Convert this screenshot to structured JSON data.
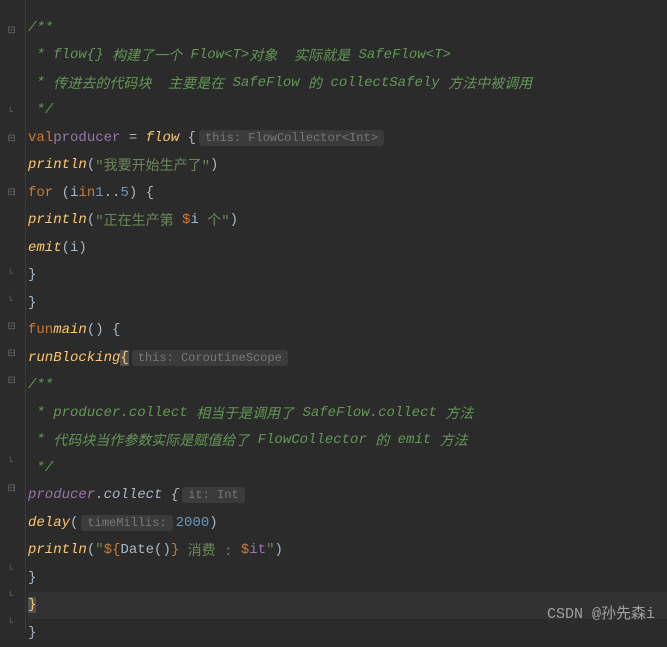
{
  "doc": {
    "l1": "/**",
    "l2a": " * flow{}",
    "l2b": " 构建了一个 ",
    "l2c": "Flow<T>",
    "l2d": "对象  实际就是 ",
    "l2e": "SafeFlow<T>",
    "l3a": " * ",
    "l3b": "传进去的代码块  主要是在 ",
    "l3c": "SafeFlow",
    "l3d": " 的 ",
    "l3e": "collectSafely",
    "l3f": " 方法中被调用",
    "l4": " */"
  },
  "kw": {
    "val": "val",
    "for": "for",
    "in": "in",
    "fun": "fun"
  },
  "code": {
    "producer": "producer",
    "eq": " = ",
    "flow": "flow",
    "openB": " {",
    "println": "println",
    "p1str": "\"我要开始生产了\"",
    "closeP": ")",
    "forOpen": " (",
    "i": "i",
    "range1": "1",
    "dotdot": "..",
    "range2": "5",
    "forClose": ") {",
    "p2str1": "\"正在生产第 ",
    "p2str2": " 个\"",
    "emit": "emit",
    "emitArg": "(i)",
    "closeB": "}",
    "main": "main",
    "mainParens": "() {",
    "runBlocking": "runBlocking",
    "doc2_1": "/**",
    "doc2_2a": " * producer.collect",
    "doc2_2b": " 相当于是调用了 ",
    "doc2_2c": "SafeFlow.collect",
    "doc2_2d": " 方法",
    "doc2_3a": " * ",
    "doc2_3b": "代码块当作参数实际是赋值给了 ",
    "doc2_3c": "FlowCollector",
    "doc2_3d": " 的 ",
    "doc2_3e": "emit",
    "doc2_3f": " 方法",
    "doc2_4": " */",
    "collect": ".collect {",
    "delay": "delay",
    "delayOpen": "(",
    "delayNum": "2000",
    "delayClose": ")",
    "p3open": "(",
    "p3q1": "\"",
    "date": "Date",
    "dateCall": "()",
    "p3mid": " 消费 : ",
    "it": "it",
    "p3q2": "\"",
    "dollar": "$",
    "lbrace": "{",
    "rbrace": "}"
  },
  "hints": {
    "flowCollector": "this: FlowCollector<Int>",
    "coroutineScope": "this: CoroutineScope",
    "itInt": "it: Int",
    "timeMillis": "timeMillis:"
  },
  "watermark": "CSDN @孙先森i"
}
